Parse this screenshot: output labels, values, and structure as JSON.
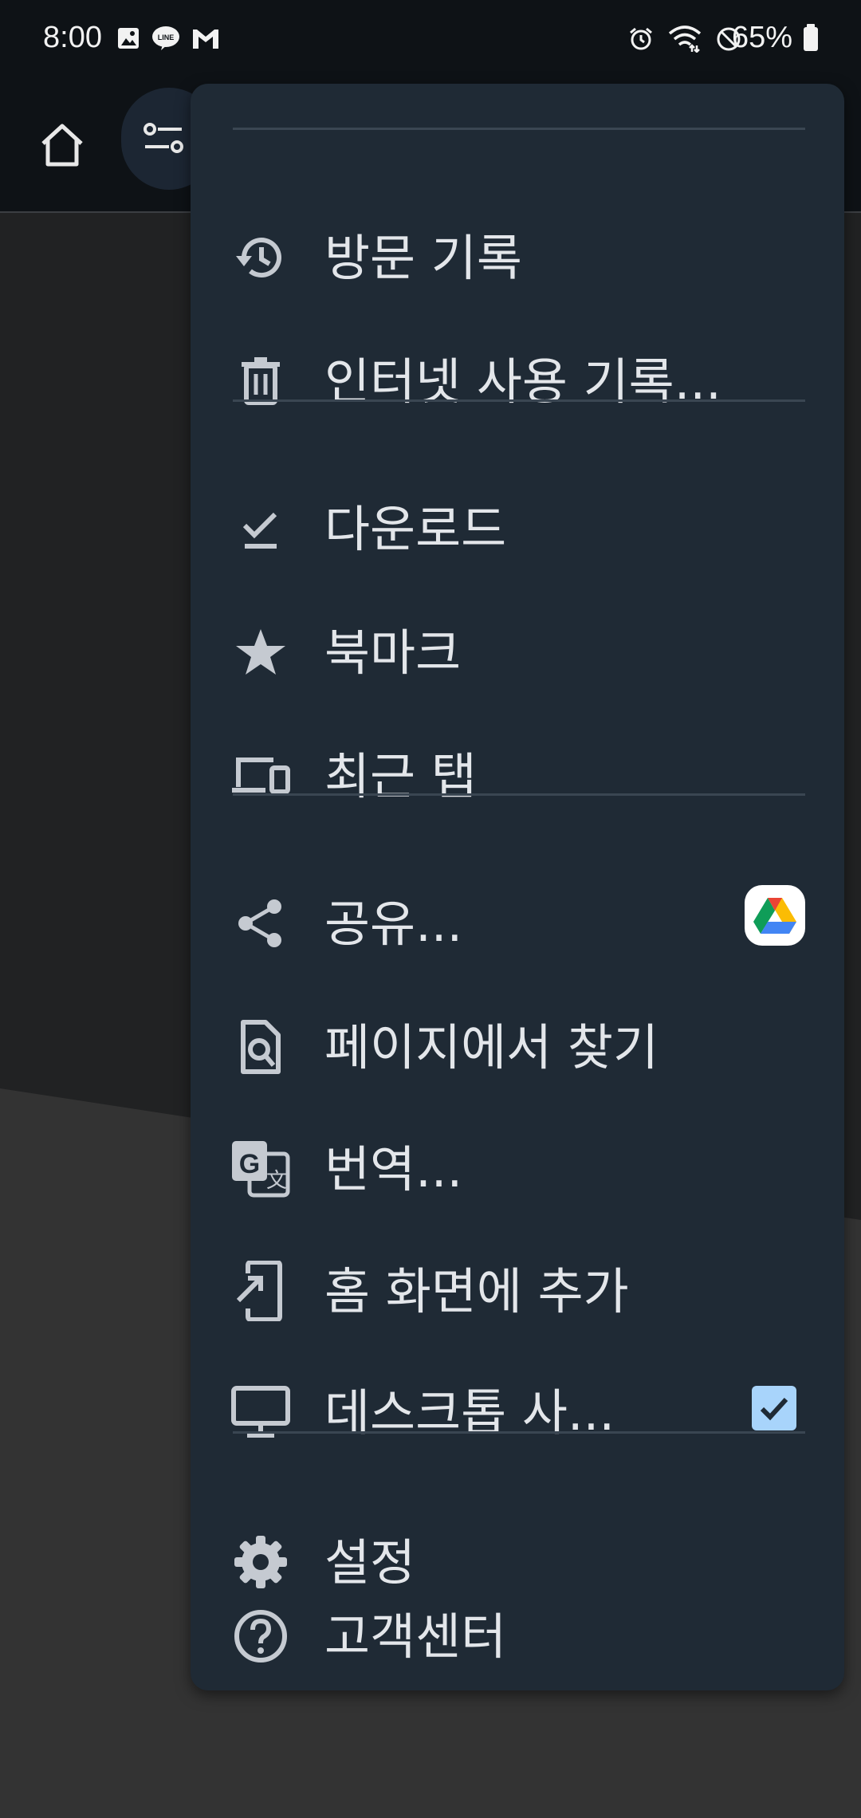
{
  "status_bar": {
    "time": "8:00",
    "battery": "65%",
    "left_icons": [
      "image-icon",
      "line-icon",
      "gmail-icon"
    ],
    "right_icons": [
      "alarm-icon",
      "wifi-icon",
      "dnd-icon",
      "battery-icon"
    ]
  },
  "toolbar": {
    "home_icon": "home-icon",
    "site_settings_icon": "tune-icon"
  },
  "menu": {
    "items": [
      {
        "label": "방문 기록",
        "icon": "history-icon"
      },
      {
        "label": "인터넷 사용 기록...",
        "icon": "trash-icon"
      },
      {
        "label": "다운로드",
        "icon": "download-done-icon"
      },
      {
        "label": "북마크",
        "icon": "star-icon"
      },
      {
        "label": "최근 탭",
        "icon": "devices-icon"
      },
      {
        "label": "공유...",
        "icon": "share-icon",
        "trailing": "google-drive-icon"
      },
      {
        "label": "페이지에서 찾기",
        "icon": "find-in-page-icon"
      },
      {
        "label": "번역...",
        "icon": "translate-icon"
      },
      {
        "label": "홈 화면에 추가",
        "icon": "add-to-home-icon"
      },
      {
        "label": "데스크톱 사...",
        "icon": "desktop-icon",
        "checked": true
      },
      {
        "label": "설정",
        "icon": "gear-icon"
      },
      {
        "label": "고객센터",
        "icon": "help-icon"
      }
    ]
  },
  "colors": {
    "menu_bg": "#1f2a35",
    "text": "#e3e6ea",
    "icon": "#c5cad1",
    "checkbox": "#a8d4fb",
    "toolbar_bg": "#0e1216"
  }
}
